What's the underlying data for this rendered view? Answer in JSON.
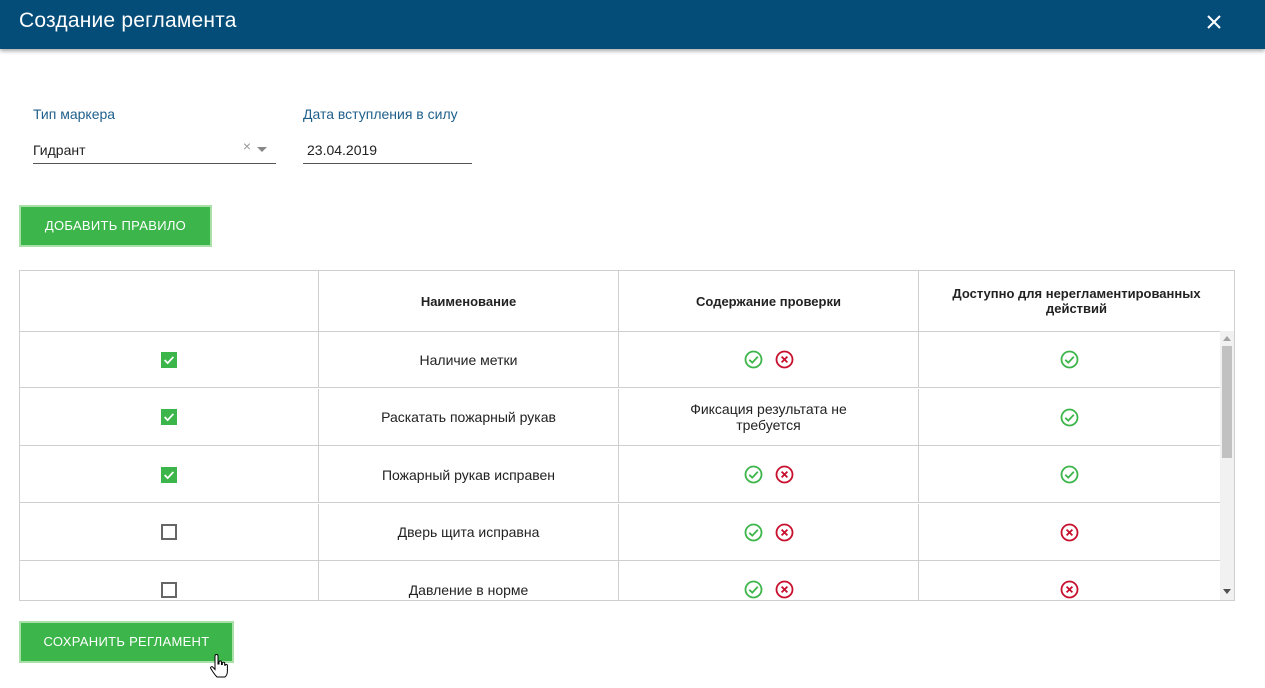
{
  "dialog": {
    "title": "Создание регламента",
    "close_icon": "close-icon"
  },
  "form": {
    "marker_type": {
      "label": "Тип маркера",
      "value": "Гидрант",
      "clear_glyph": "×"
    },
    "effective_date": {
      "label": "Дата вступления в силу",
      "value": "23.04.2019"
    }
  },
  "buttons": {
    "add_rule": "ДОБАВИТЬ ПРАВИЛО",
    "save": "СОХРАНИТЬ РЕГЛАМЕНТ"
  },
  "table": {
    "columns": [
      "",
      "Наименование",
      "Содержание проверки",
      "Доступно для нерегламентированных действий"
    ],
    "rows": [
      {
        "checked": true,
        "name": "Наличие метки",
        "check_content": "icons",
        "check_text": "",
        "available": "yes"
      },
      {
        "checked": true,
        "name": "Раскатать пожарный рукав",
        "check_content": "text",
        "check_text": "Фиксация результата не требуется",
        "available": "yes"
      },
      {
        "checked": true,
        "name": "Пожарный рукав исправен",
        "check_content": "icons",
        "check_text": "",
        "available": "yes"
      },
      {
        "checked": false,
        "name": "Дверь щита исправна",
        "check_content": "icons",
        "check_text": "",
        "available": "no"
      },
      {
        "checked": false,
        "name": "Давление в норме",
        "check_content": "icons",
        "check_text": "",
        "available": "no"
      }
    ]
  },
  "colors": {
    "header_bg": "#044d79",
    "button_green": "#3cb54a",
    "icon_ok": "#3cb54a",
    "icon_fail": "#c8102e",
    "label_blue": "#1f5f8b"
  }
}
